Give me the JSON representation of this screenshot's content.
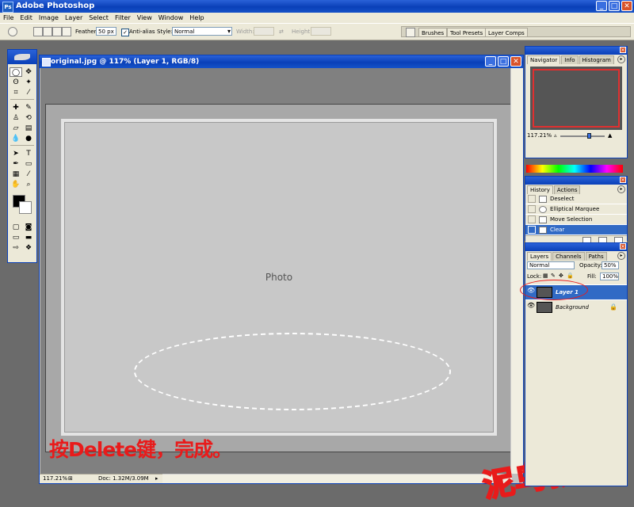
{
  "app": {
    "title": "Adobe Photoshop",
    "icon": "photoshop-icon"
  },
  "menu": [
    "File",
    "Edit",
    "Image",
    "Layer",
    "Select",
    "Filter",
    "View",
    "Window",
    "Help"
  ],
  "options": {
    "feather_label": "Feather:",
    "feather_value": "50 px",
    "antialias_label": "Anti-alias",
    "antialias_checked": "✓",
    "style_label": "Style:",
    "style_value": "Normal",
    "width_label": "Width:",
    "height_label": "Height:"
  },
  "palette_well": [
    "Brushes",
    "Tool Presets",
    "Layer Comps"
  ],
  "document": {
    "title": "original.jpg @ 117% (Layer 1, RGB/8)",
    "zoom": "117.21%",
    "doc_size": "Doc: 1.32M/3.09M",
    "image_placeholder_label": "Photo"
  },
  "caption": "按Delete键，完成。",
  "watermark": "泥鸟教程",
  "navigator": {
    "tabs": [
      "Navigator",
      "Info",
      "Histogram"
    ],
    "zoom": "117.21%"
  },
  "history": {
    "tabs": [
      "History",
      "Actions"
    ],
    "items": [
      {
        "label": "Deselect",
        "icon": "document-icon"
      },
      {
        "label": "Elliptical Marquee",
        "icon": "ellipse-icon"
      },
      {
        "label": "Move Selection",
        "icon": "move-icon"
      },
      {
        "label": "Clear",
        "icon": "document-icon"
      }
    ]
  },
  "layers": {
    "tabs": [
      "Layers",
      "Channels",
      "Paths"
    ],
    "blend_mode": "Normal",
    "opacity_label": "Opacity:",
    "opacity_value": "50%",
    "lock_label": "Lock:",
    "fill_label": "Fill:",
    "fill_value": "100%",
    "items": [
      {
        "name": "Layer 1",
        "selected": true
      },
      {
        "name": "Background",
        "selected": false,
        "locked": true
      }
    ]
  }
}
